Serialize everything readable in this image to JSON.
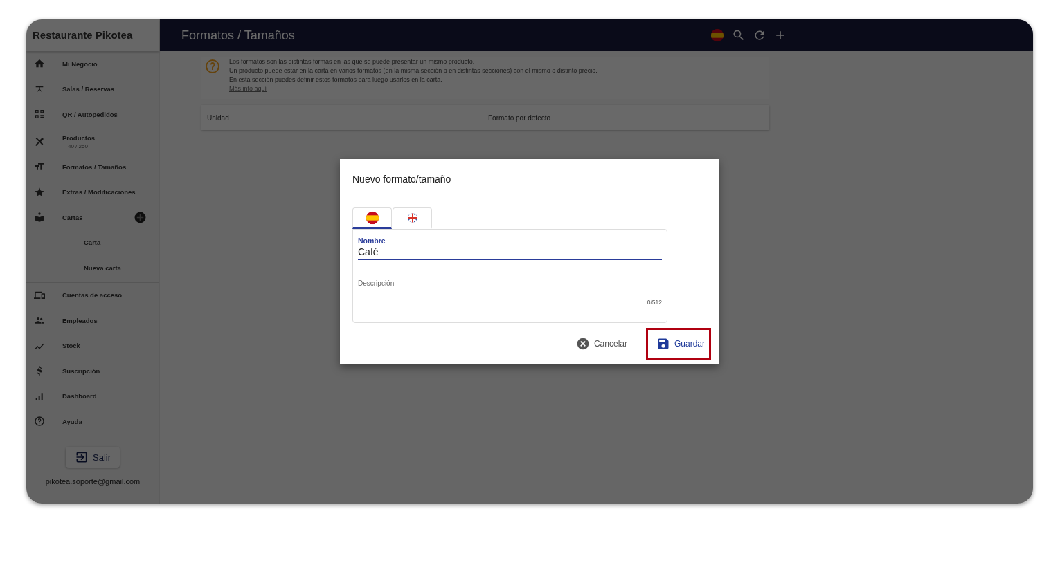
{
  "sidebar": {
    "title": "Restaurante Pikotea",
    "sections": [
      [
        {
          "kind": "item",
          "label": "Mi Negocio"
        },
        {
          "kind": "item",
          "label": "Salas / Reservas"
        },
        {
          "kind": "item",
          "label": "QR / Autopedidos"
        }
      ],
      [
        {
          "kind": "item",
          "label": "Productos",
          "count": "40 / 250"
        },
        {
          "kind": "item",
          "label": "Formatos / Tamaños"
        },
        {
          "kind": "item",
          "label": "Extras / Modificaciones"
        },
        {
          "kind": "group",
          "label": "Cartas"
        },
        {
          "kind": "subitem",
          "label": "Carta"
        },
        {
          "kind": "subitem",
          "label": "Nueva carta"
        }
      ],
      [
        {
          "kind": "item",
          "label": "Cuentas de acceso"
        },
        {
          "kind": "item",
          "label": "Empleados"
        },
        {
          "kind": "item",
          "label": "Stock"
        },
        {
          "kind": "item",
          "label": "Suscripción"
        },
        {
          "kind": "item",
          "label": "Dashboard"
        },
        {
          "kind": "item",
          "label": "Ayuda"
        }
      ]
    ],
    "logout": "Salir",
    "email": "pikotea.soporte@gmail.com"
  },
  "header": {
    "title": "Formatos / Tamaños"
  },
  "info": {
    "lines": [
      "Los formatos son las distintas formas en las que se puede presentar un mismo producto.",
      "Un producto puede estar en la carta en varios formatos (en la misma sección o en distintas secciones) con el mismo o distinto precio.",
      "En esta sección puedes definir estos formatos para luego usarlos en la carta."
    ],
    "link": "Más info aquí"
  },
  "table": {
    "columns": [
      "Unidad",
      "Formato por defecto"
    ]
  },
  "dialog": {
    "title": "Nuevo formato/tamaño",
    "tabs": [
      {
        "kind": "spain",
        "selected": true
      },
      {
        "kind": "uk",
        "selected": false
      }
    ],
    "name_field": {
      "label": "Nombre",
      "value": "Café"
    },
    "description_field": {
      "placeholder": "Descripción",
      "counter": "0/512"
    },
    "buttons": [
      {
        "kind": "cancel",
        "label": "Cancelar",
        "highlighted": false
      },
      {
        "kind": "save",
        "label": "Guardar",
        "highlighted": true
      }
    ]
  }
}
